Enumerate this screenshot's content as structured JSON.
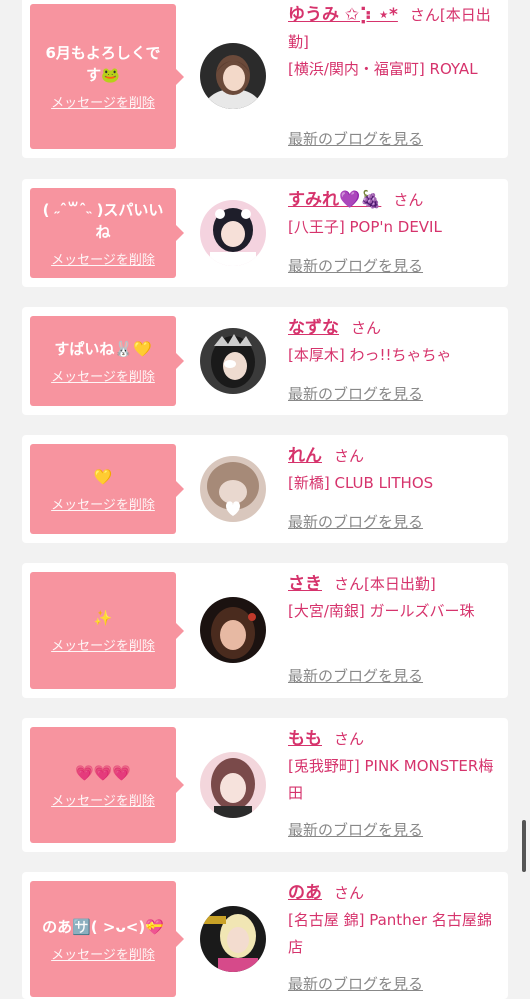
{
  "cards": [
    {
      "message": "6月もよろしくです🐸",
      "delete_label": "メッセージを削除",
      "name": "ゆうみ ✩︎⡱ ⋆*",
      "honorific": "さん",
      "status": "[本日出勤]",
      "shop": "[横浜/関内・福富町] ROYAL",
      "blog_label": "最新のブログを見る"
    },
    {
      "message": "( ˶ˆ꒳ˆ˵ )スパいいね",
      "delete_label": "メッセージを削除",
      "name": "すみれ💜🍇",
      "honorific": "さん",
      "status": "",
      "shop": "[八王子] POP'n DEVIL",
      "blog_label": "最新のブログを見る"
    },
    {
      "message": "すぱいね🐰💛",
      "delete_label": "メッセージを削除",
      "name": "なずな",
      "honorific": "さん",
      "status": "",
      "shop": "[本厚木] わっ!!ちゃちゃ",
      "blog_label": "最新のブログを見る"
    },
    {
      "message": "💛",
      "delete_label": "メッセージを削除",
      "name": "れん",
      "honorific": "さん",
      "status": "",
      "shop": "[新橋] CLUB LITHOS",
      "blog_label": "最新のブログを見る"
    },
    {
      "message": "✨",
      "delete_label": "メッセージを削除",
      "name": "さき",
      "honorific": "さん",
      "status": "[本日出勤]",
      "shop": "[大宮/南銀] ガールズバー珠",
      "blog_label": "最新のブログを見る"
    },
    {
      "message": "💗💗💗",
      "delete_label": "メッセージを削除",
      "name": "もも",
      "honorific": "さん",
      "status": "",
      "shop": "[兎我野町] PINK MONSTER梅田",
      "blog_label": "最新のブログを見る"
    },
    {
      "message": "のあ🈂️( >ᴗ<)💝",
      "delete_label": "メッセージを削除",
      "name": "のあ",
      "honorific": "さん",
      "status": "",
      "shop": "[名古屋 錦] Panther 名古屋錦店",
      "blog_label": "最新のブログを見る"
    }
  ],
  "colors": {
    "accent": "#d6336c",
    "bubble": "#f7949f",
    "background": "#f2f2f2",
    "card": "#ffffff",
    "muted": "#888888"
  }
}
